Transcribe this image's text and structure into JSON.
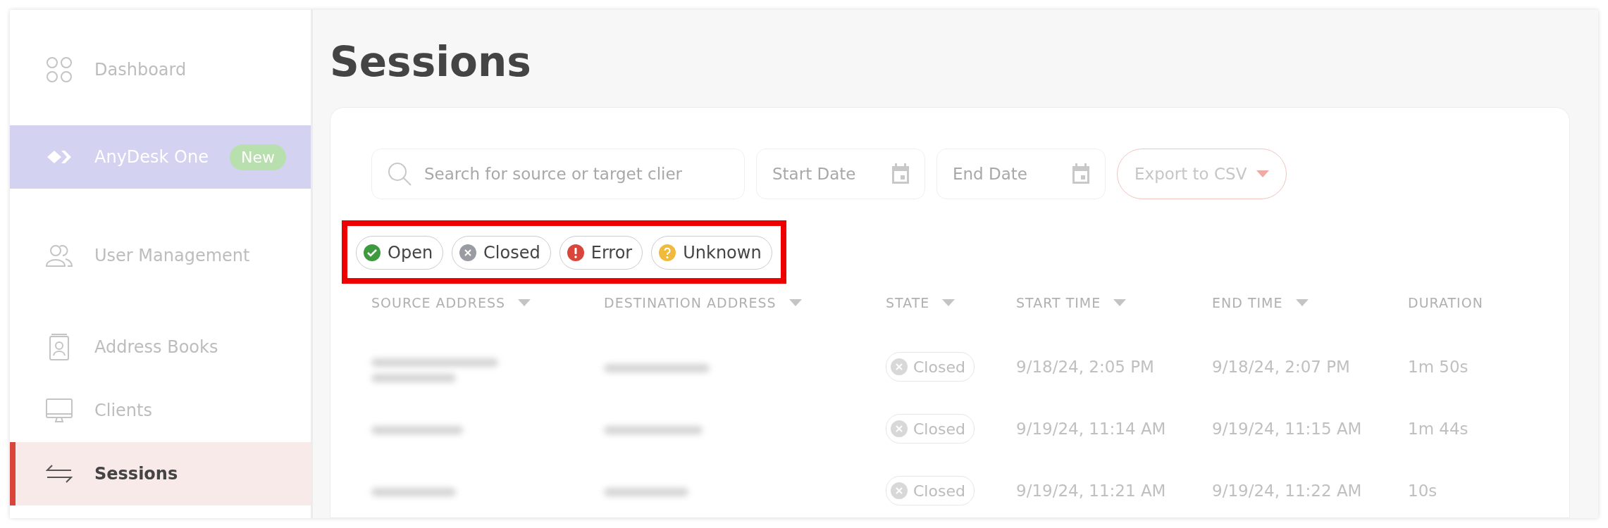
{
  "sidebar": {
    "items": [
      {
        "label": "Dashboard",
        "selected": false,
        "highlighted": false
      },
      {
        "label": "AnyDesk One",
        "selected": false,
        "highlighted": true,
        "badge": "New"
      },
      {
        "label": "User Management",
        "selected": false,
        "highlighted": false
      },
      {
        "label": "Address Books",
        "selected": false,
        "highlighted": false
      },
      {
        "label": "Clients",
        "selected": false,
        "highlighted": false
      },
      {
        "label": "Sessions",
        "selected": true,
        "highlighted": false
      }
    ]
  },
  "page_title": "Sessions",
  "filters": {
    "search": {
      "placeholder": "Search for source or target clier"
    },
    "start_date": {
      "placeholder": "Start Date"
    },
    "end_date": {
      "placeholder": "End Date"
    },
    "export_button": "Export to CSV"
  },
  "state_filters": [
    {
      "label": "Open",
      "kind": "open",
      "color": "#3e9a3e"
    },
    {
      "label": "Closed",
      "kind": "closed",
      "color": "#9a9ca3"
    },
    {
      "label": "Error",
      "kind": "error",
      "color": "#d9453a"
    },
    {
      "label": "Unknown",
      "kind": "unknown",
      "color": "#f0bb3c"
    }
  ],
  "table": {
    "columns": [
      {
        "label": "SOURCE ADDRESS",
        "sortable": true
      },
      {
        "label": "DESTINATION ADDRESS",
        "sortable": true
      },
      {
        "label": "STATE",
        "sortable": true
      },
      {
        "label": "START TIME",
        "sortable": true
      },
      {
        "label": "END TIME",
        "sortable": true
      },
      {
        "label": "DURATION",
        "sortable": false
      }
    ],
    "rows": [
      {
        "state": {
          "label": "Closed",
          "kind": "closed"
        },
        "start_time": "9/18/24, 2:05 PM",
        "end_time": "9/18/24, 2:07 PM",
        "duration": "1m 50s"
      },
      {
        "state": {
          "label": "Closed",
          "kind": "closed"
        },
        "start_time": "9/19/24, 11:14 AM",
        "end_time": "9/19/24, 11:15 AM",
        "duration": "1m 44s"
      },
      {
        "state": {
          "label": "Closed",
          "kind": "closed"
        },
        "start_time": "9/19/24, 11:21 AM",
        "end_time": "9/19/24, 11:22 AM",
        "duration": "10s"
      }
    ]
  }
}
